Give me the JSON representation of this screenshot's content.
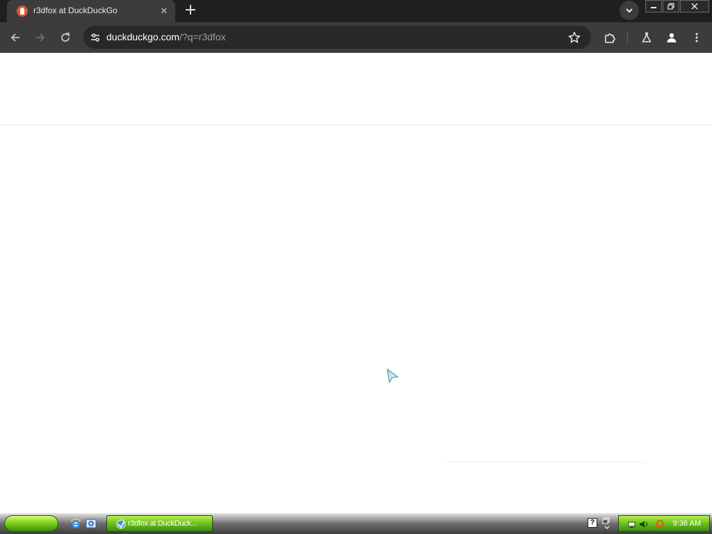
{
  "browser": {
    "tab": {
      "title": "r3dfox at DuckDuckGo",
      "favicon": "duckduckgo-icon",
      "close_icon": "close-icon"
    },
    "new_tab_label": "+",
    "tab_search_icon": "chevron-down-icon",
    "window_controls": {
      "minimize": "minimize-icon",
      "restore": "restore-icon",
      "close": "close-icon"
    },
    "toolbar": {
      "back_icon": "back-arrow-icon",
      "forward_icon": "forward-arrow-icon",
      "reload_icon": "reload-icon",
      "site_info_icon": "tune-icon",
      "bookmark_icon": "star-icon",
      "extensions_icon": "puzzle-icon",
      "labs_icon": "flask-icon",
      "profile_icon": "profile-icon",
      "menu_icon": "kebab-menu-icon"
    },
    "address": {
      "host": "duckduckgo.com",
      "path": "/?q=r3dfox"
    },
    "colors": {
      "tabstrip_bg": "#1f1f1f",
      "toolbar_bg": "#3c3c3c",
      "omnibox_bg": "#282828",
      "favicon": "#de5833"
    }
  },
  "taskbar": {
    "start_icon": "start-button",
    "quick_launch": [
      "internet-explorer-icon",
      "outlook-express-icon"
    ],
    "task": {
      "label": "r3dfox at DuckDuck...",
      "icon": "browser-icon"
    },
    "help_label": "?",
    "tray_icons": [
      "network-icon",
      "volume-icon",
      "search-icon"
    ],
    "clock": "9:36 AM",
    "colors": {
      "accent": "#6cbf1f"
    }
  }
}
